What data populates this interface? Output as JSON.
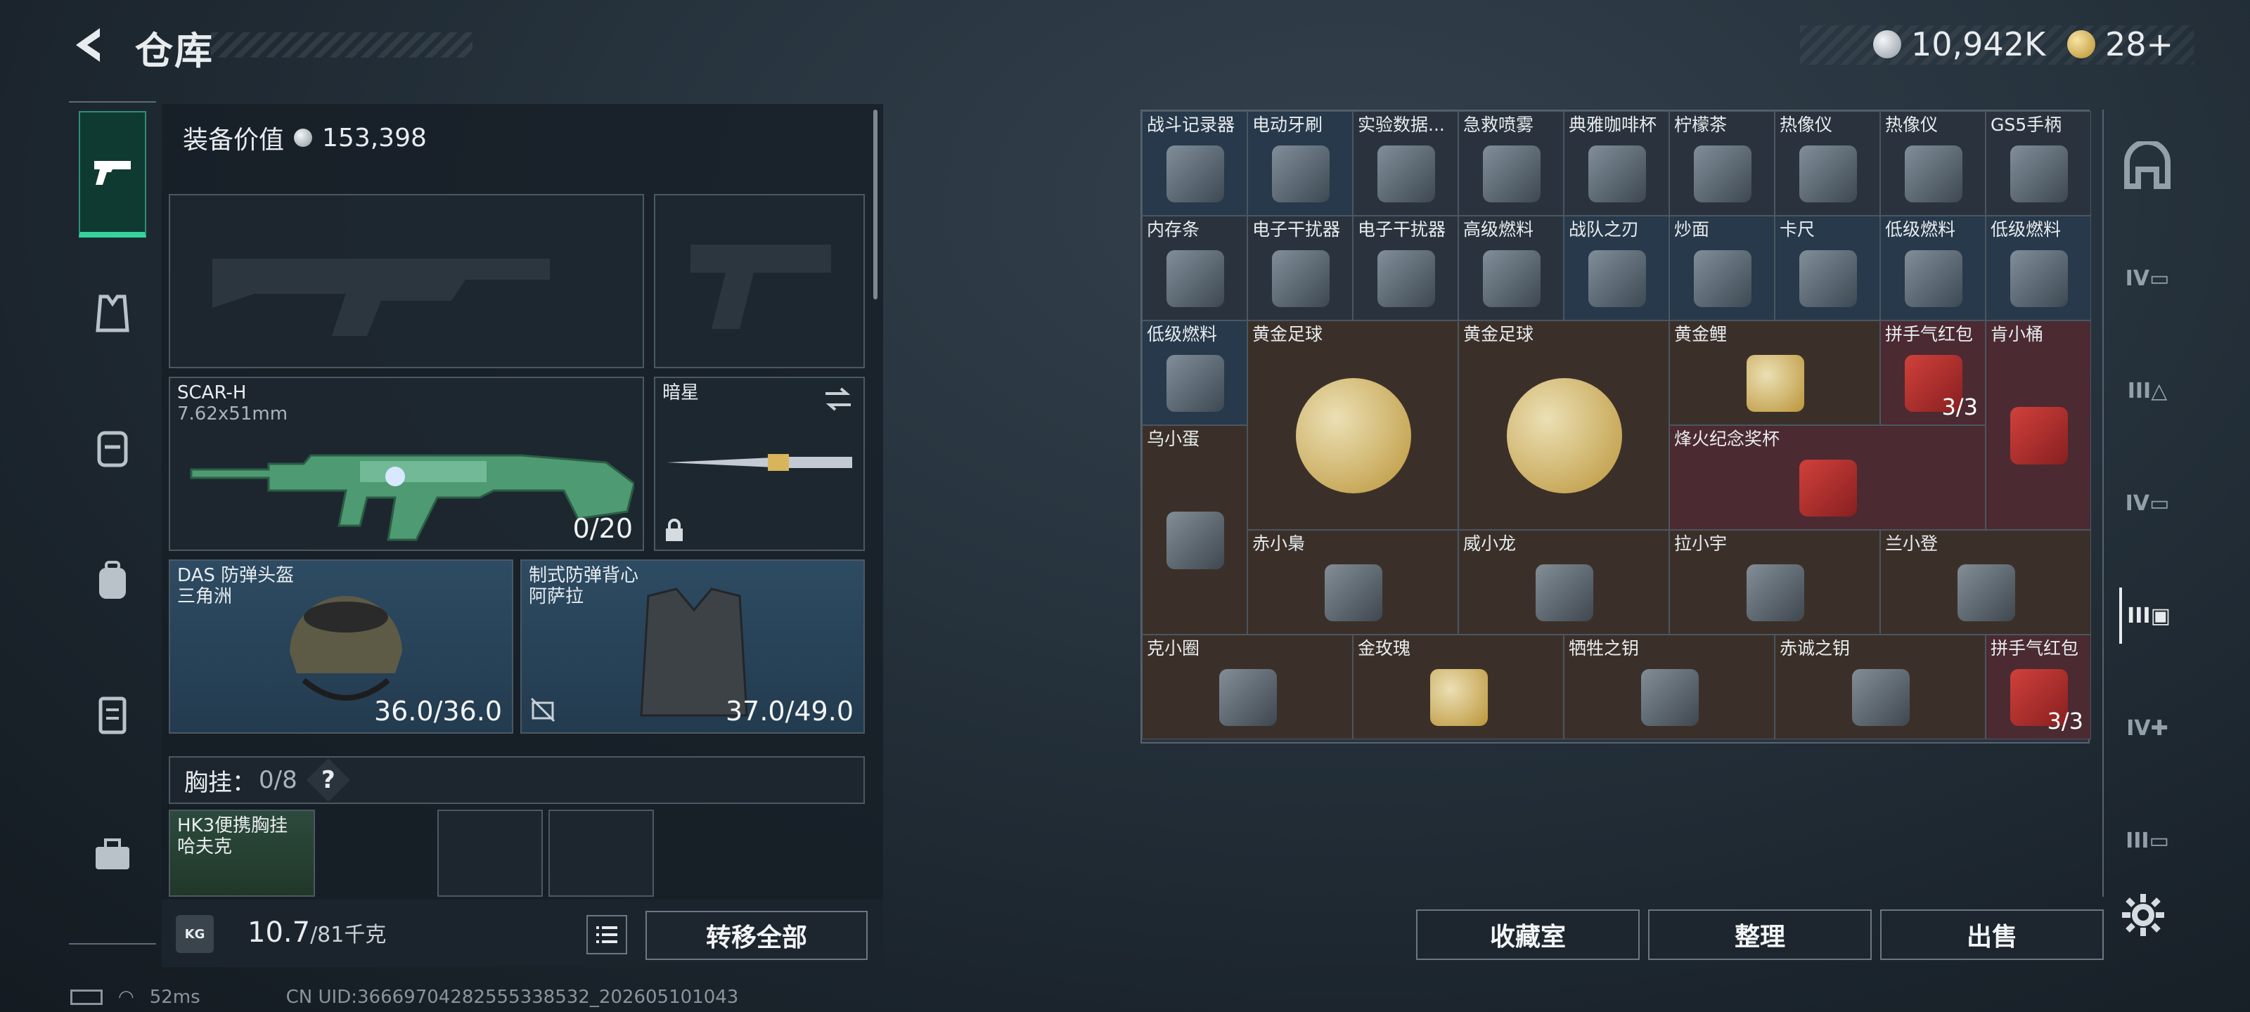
{
  "header": {
    "title": "仓库",
    "currency1": "10,942K",
    "currency2": "28+",
    "colors": {
      "accent": "#35d49d",
      "gold": "#d8b45a"
    }
  },
  "left_tabs": [
    {
      "icon": "pistol-icon",
      "active": true
    },
    {
      "icon": "vest-icon"
    },
    {
      "icon": "backpack-helmet-icon"
    },
    {
      "icon": "backpack-icon"
    },
    {
      "icon": "case-icon"
    },
    {
      "icon": "toolbox-icon"
    }
  ],
  "equipment": {
    "value_label": "装备价值",
    "value": "153,398",
    "primary": {
      "name": "SCAR-H",
      "ammo": "7.62x51mm",
      "count": "0/20"
    },
    "melee": {
      "name": "暗星"
    },
    "helmet": {
      "name": "DAS 防弹头盔",
      "origin": "三角洲",
      "durability": "36.0/36.0"
    },
    "armor": {
      "name": "制式防弹背心",
      "origin": "阿萨拉",
      "durability": "37.0/49.0"
    },
    "chest": {
      "label": "胸挂：",
      "count": "0/8",
      "help": "?"
    },
    "chest_item": {
      "name": "HK3便携胸挂",
      "origin": "哈夫克"
    }
  },
  "weight": {
    "icon": "kg-weight-icon",
    "current": "10.7",
    "max": "/81千克"
  },
  "buttons": {
    "transfer_all": "转移全部",
    "collection": "收藏室",
    "organize": "整理",
    "sell": "出售"
  },
  "items": [
    {
      "name": "战斗记录器",
      "bg": "blue"
    },
    {
      "name": "电动牙刷",
      "bg": "blue"
    },
    {
      "name": "实验数据...",
      "bg": "gray"
    },
    {
      "name": "急救喷雾",
      "bg": "gray"
    },
    {
      "name": "典雅咖啡杯",
      "bg": "gray"
    },
    {
      "name": "柠檬茶",
      "bg": "gray"
    },
    {
      "name": "热像仪",
      "bg": "gray"
    },
    {
      "name": "热像仪",
      "bg": "gray"
    },
    {
      "name": "GS5手柄",
      "bg": "gray"
    },
    {
      "name": "内存条",
      "bg": "gray"
    },
    {
      "name": "电子干扰器",
      "bg": "gray"
    },
    {
      "name": "电子干扰器",
      "bg": "gray"
    },
    {
      "name": "高级燃料",
      "bg": "gray"
    },
    {
      "name": "战队之刃",
      "bg": "blue"
    },
    {
      "name": "炒面",
      "bg": "blue"
    },
    {
      "name": "卡尺",
      "bg": "blue"
    },
    {
      "name": "低级燃料",
      "bg": "blue"
    },
    {
      "name": "低级燃料",
      "bg": "blue"
    },
    {
      "name": "低级燃料",
      "bg": "blue"
    },
    {
      "name": "黄金足球",
      "bg": "brown"
    },
    {
      "name": "黄金足球",
      "bg": "brown"
    },
    {
      "name": "黄金鲤",
      "bg": "brown"
    },
    {
      "name": "拼手气红包",
      "bg": "red",
      "count": "3/3"
    },
    {
      "name": "肯小桶",
      "bg": "red"
    },
    {
      "name": "乌小蛋",
      "bg": "brown"
    },
    {
      "name": "烽火纪念奖杯",
      "bg": "red"
    },
    {
      "name": "赤小梟",
      "bg": "brown"
    },
    {
      "name": "威小龙",
      "bg": "brown"
    },
    {
      "name": "拉小宇",
      "bg": "brown"
    },
    {
      "name": "兰小登",
      "bg": "brown"
    },
    {
      "name": "克小圈",
      "bg": "brown"
    },
    {
      "name": "金玫瑰",
      "bg": "brown"
    },
    {
      "name": "牺牲之钥",
      "bg": "brown"
    },
    {
      "name": "赤诚之钥",
      "bg": "brown"
    },
    {
      "name": "拼手气红包",
      "bg": "red",
      "count": "3/3"
    }
  ],
  "right_tabs": [
    {
      "icon": "safehouse-icon",
      "text": ""
    },
    {
      "icon": "case-iv-icon",
      "text": "IV"
    },
    {
      "icon": "case-iii-icon",
      "text": "III"
    },
    {
      "icon": "case-iv-icon",
      "text": "IV"
    },
    {
      "icon": "case-iii-icon",
      "text": "III"
    },
    {
      "icon": "case-iv-icon",
      "text": "IV"
    },
    {
      "icon": "case-iii-icon",
      "text": "III"
    }
  ],
  "status": {
    "ping": "52ms",
    "uid": "CN UID:3666970428255533853​2_202605101043"
  }
}
